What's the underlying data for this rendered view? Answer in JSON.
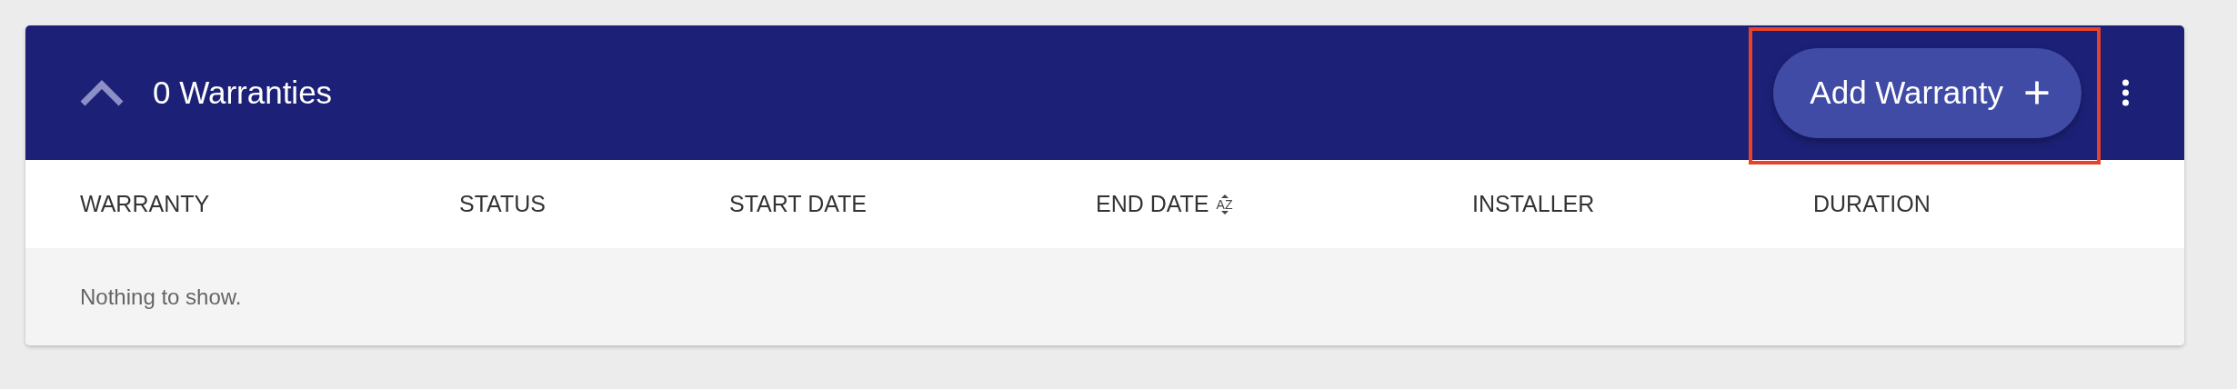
{
  "panel": {
    "title": "0 Warranties",
    "expanded": true,
    "add_button": {
      "label": "Add Warranty",
      "highlighted": true
    }
  },
  "table": {
    "columns": [
      {
        "label": "WARRANTY"
      },
      {
        "label": "STATUS"
      },
      {
        "label": "START DATE"
      },
      {
        "label": "END DATE",
        "sort_label": "AZ"
      },
      {
        "label": "INSTALLER"
      },
      {
        "label": "DURATION"
      }
    ],
    "empty_message": "Nothing to show."
  }
}
